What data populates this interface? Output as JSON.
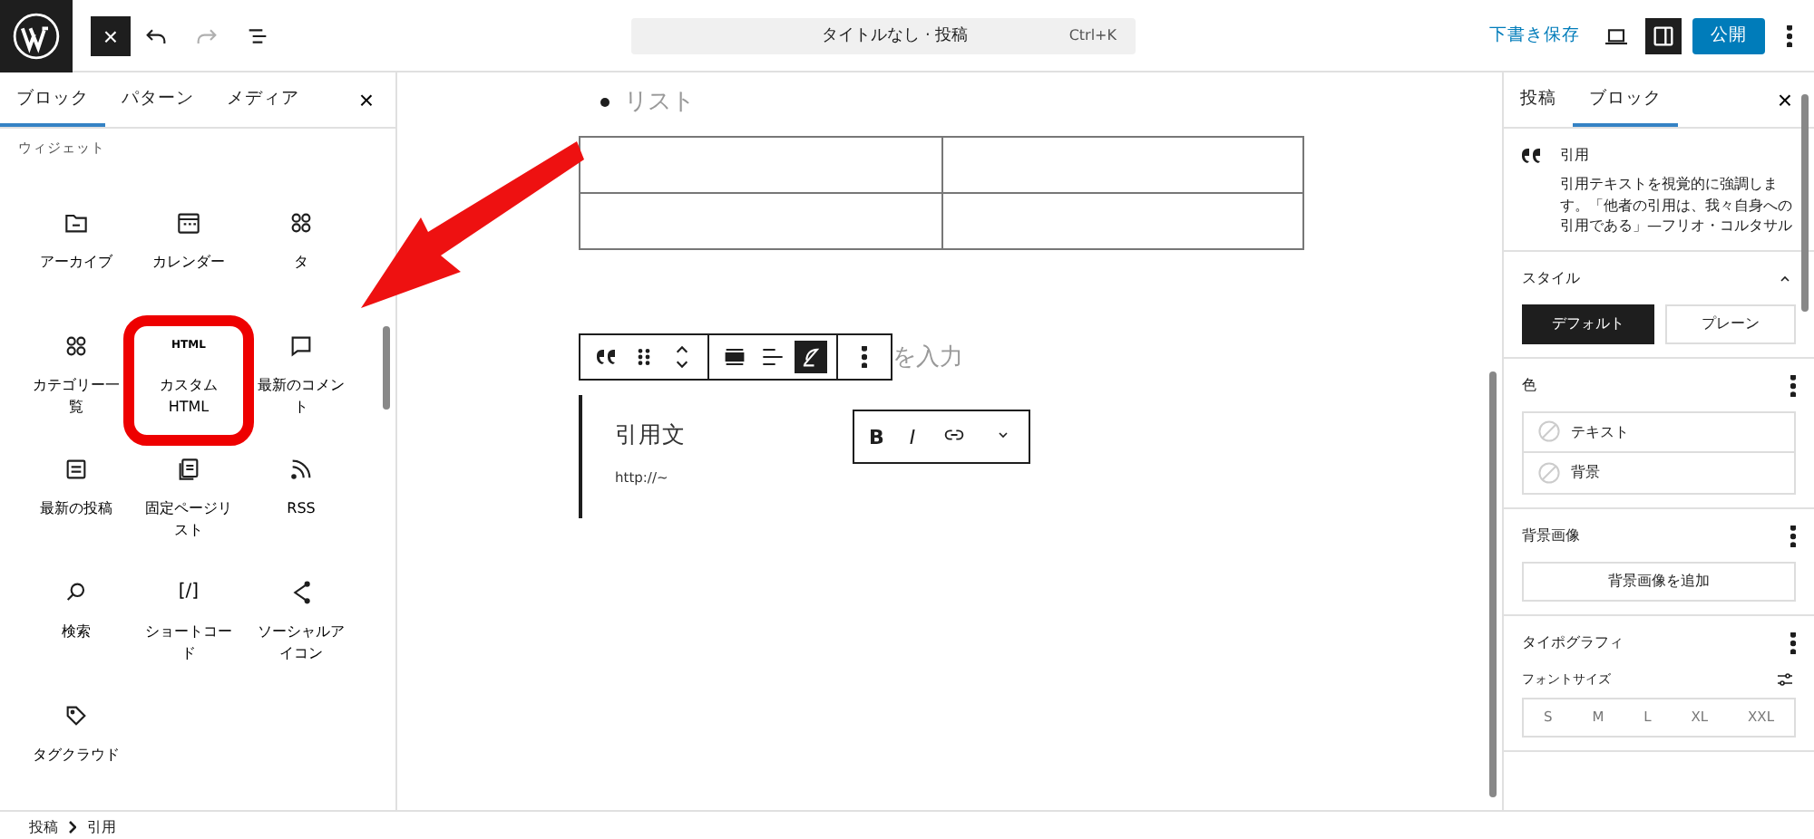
{
  "top_bar": {
    "close": "×",
    "command_bar": {
      "title": "タイトルなし · 投稿",
      "shortcut": "Ctrl+K"
    },
    "redo_disabled": true,
    "save_draft": "下書き保存",
    "settings_selected": true,
    "publish": "公開"
  },
  "inserter": {
    "tabs": [
      {
        "label": "ブロック",
        "selected": true
      },
      {
        "label": "パターン",
        "selected": false
      },
      {
        "label": "メディア",
        "selected": false
      }
    ],
    "close": "×",
    "section": "ウィジェット",
    "blocks": [
      {
        "kind": "archive",
        "label": "アーカイブ",
        "highlighted": false
      },
      {
        "kind": "calendar",
        "label": "カレンダー",
        "highlighted": false
      },
      {
        "kind": "grid",
        "label": "タ",
        "highlighted": false
      },
      {
        "kind": "grid",
        "label": "カテゴリー一覧",
        "highlighted": false
      },
      {
        "kind": "html",
        "label": "カスタムHTML",
        "icon_text": "HTML",
        "highlighted": true
      },
      {
        "kind": "comment",
        "label": "最新のコメント",
        "highlighted": false
      },
      {
        "kind": "posts",
        "label": "最新の投稿",
        "highlighted": false
      },
      {
        "kind": "pages",
        "label": "固定ページリスト",
        "highlighted": false
      },
      {
        "kind": "rss",
        "label": "RSS",
        "highlighted": false
      },
      {
        "kind": "search",
        "label": "検索",
        "highlighted": false
      },
      {
        "kind": "shortcode",
        "label": "ショートコード",
        "icon_text": "[/]",
        "highlighted": false
      },
      {
        "kind": "share",
        "label": "ソーシャルアイコン",
        "highlighted": false
      },
      {
        "kind": "tag",
        "label": "タグクラウド",
        "highlighted": false
      }
    ]
  },
  "editor": {
    "list_item": "リスト",
    "table": {
      "rows": [
        [
          "",
          ""
        ],
        [
          "",
          ""
        ]
      ]
    },
    "paragraph_placeholder": "を入力",
    "block_toolbar": [
      {
        "kind": "quote",
        "selected": false
      },
      {
        "kind": "drag",
        "selected": false
      },
      {
        "kind": "move",
        "selected": false
      },
      {
        "kind": "align-wide",
        "selected": false
      },
      {
        "kind": "align-left",
        "selected": false
      },
      {
        "kind": "style",
        "selected": true
      },
      {
        "kind": "more",
        "selected": false
      }
    ],
    "quote": {
      "text": "引用文",
      "citation": "http://~"
    },
    "format_toolbar": [
      {
        "kind": "bold",
        "label": "B"
      },
      {
        "kind": "italic",
        "label": "I"
      },
      {
        "kind": "link"
      },
      {
        "kind": "chevron"
      }
    ]
  },
  "sidebar": {
    "tabs": [
      {
        "label": "投稿",
        "selected": false
      },
      {
        "label": "ブロック",
        "selected": true
      }
    ],
    "close": "×",
    "block_card": {
      "title": "引用",
      "description": "引用テキストを視覚的に強調します。「他者の引用は、我々自身への引用である」—フリオ・コルタサル"
    },
    "style": {
      "title": "スタイル",
      "expanded": true,
      "options": [
        {
          "label": "デフォルト",
          "selected": true
        },
        {
          "label": "プレーン",
          "selected": false
        }
      ]
    },
    "color": {
      "title": "色",
      "items": [
        "テキスト",
        "背景"
      ]
    },
    "background_image": {
      "title": "背景画像",
      "button": "背景画像を追加"
    },
    "typography": {
      "title": "タイポグラフィ",
      "font_size_label": "フォントサイズ",
      "sizes": [
        "S",
        "M",
        "L",
        "XL",
        "XXL"
      ]
    }
  },
  "breadcrumb": [
    "投稿",
    "引用"
  ]
}
